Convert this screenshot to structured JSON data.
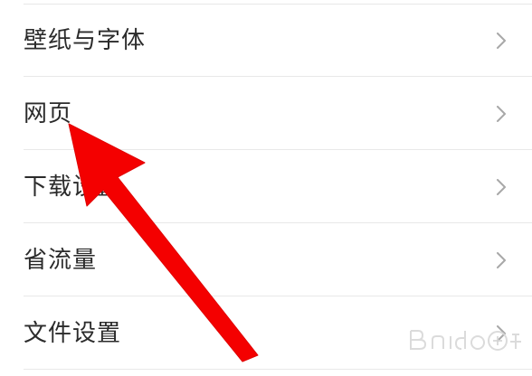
{
  "settings": {
    "items": [
      {
        "label": "壁纸与字体",
        "icon": "chevron-right-icon"
      },
      {
        "label": "网页",
        "icon": "chevron-right-icon"
      },
      {
        "label": "下载设置",
        "icon": "chevron-right-icon"
      },
      {
        "label": "省流量",
        "icon": "chevron-right-icon"
      },
      {
        "label": "文件设置",
        "icon": "chevron-right-icon"
      }
    ]
  },
  "annotation": {
    "arrow_color": "#f40000",
    "arrow_icon": "red-arrow-icon"
  },
  "watermark": {
    "icon": "baidu-jingyan-watermark-icon"
  },
  "colors": {
    "text": "#2b2b2b",
    "chevron": "#a8a8a8",
    "divider": "#e8e8e8",
    "background": "#ffffff"
  }
}
